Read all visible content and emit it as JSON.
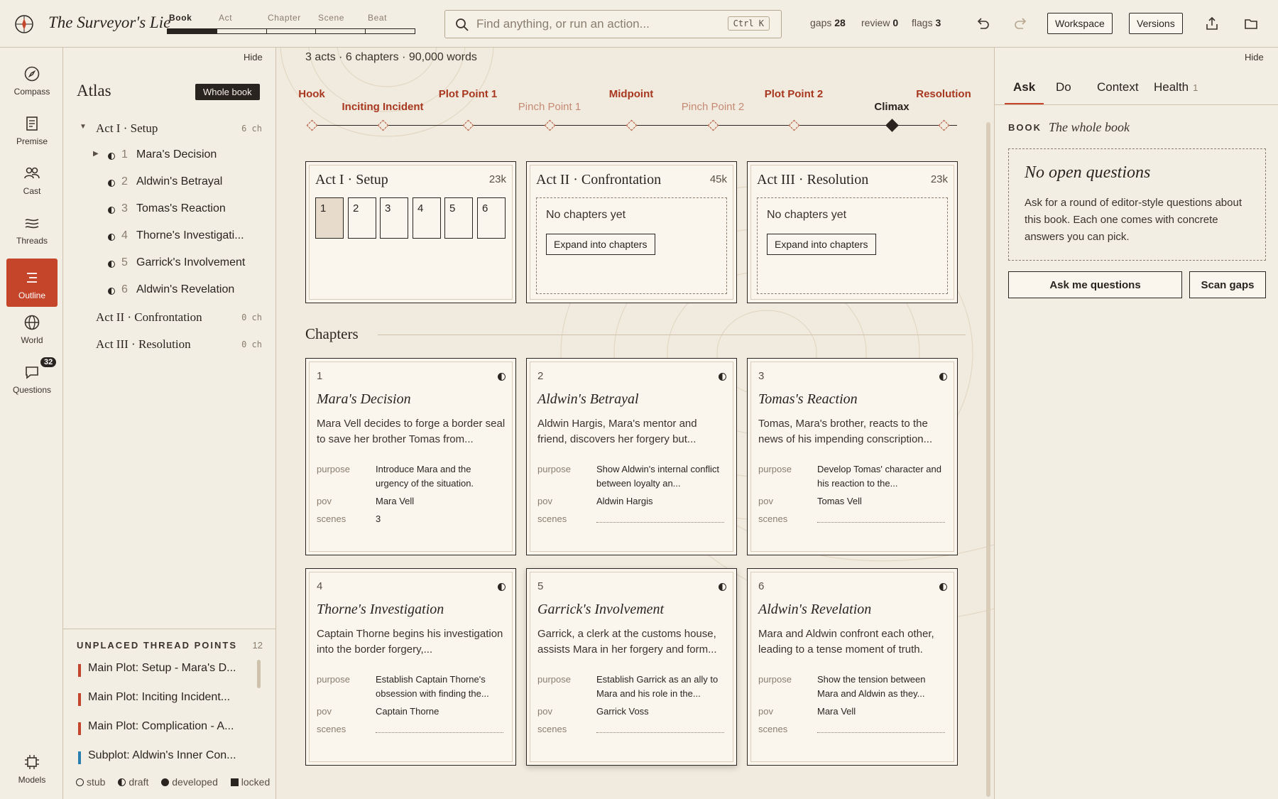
{
  "header": {
    "book_title": "The Surveyor's Lie",
    "scope_tabs": [
      "Book",
      "Act",
      "Chapter",
      "Scene",
      "Beat"
    ],
    "search_placeholder": "Find anything, or run an action...",
    "search_shortcut": "Ctrl K",
    "stats": {
      "gaps_label": "gaps",
      "gaps": "28",
      "review_label": "review",
      "review": "0",
      "flags_label": "flags",
      "flags": "3"
    },
    "workspace_label": "Workspace",
    "versions_label": "Versions"
  },
  "rail": {
    "items": [
      "Compass",
      "Premise",
      "Cast",
      "Threads",
      "Outline",
      "World",
      "Questions"
    ],
    "active": "Outline",
    "questions_badge": "32",
    "models_label": "Models"
  },
  "atlas": {
    "hide_label": "Hide",
    "title": "Atlas",
    "whole_book_label": "Whole book",
    "acts": [
      {
        "label": "Act I · Setup",
        "count": "6 ch"
      },
      {
        "label": "Act II · Confrontation",
        "count": "0 ch"
      },
      {
        "label": "Act III · Resolution",
        "count": "0 ch"
      }
    ],
    "chapters": [
      {
        "num": "1",
        "title": "Mara's Decision"
      },
      {
        "num": "2",
        "title": "Aldwin's Betrayal"
      },
      {
        "num": "3",
        "title": "Tomas's Reaction"
      },
      {
        "num": "4",
        "title": "Thorne's Investigati..."
      },
      {
        "num": "5",
        "title": "Garrick's Involvement"
      },
      {
        "num": "6",
        "title": "Aldwin's Revelation"
      }
    ],
    "unplaced_title": "UNPLACED THREAD POINTS",
    "unplaced_count": "12",
    "thread_points": [
      "Main Plot: Setup - Mara's D...",
      "Main Plot: Inciting Incident...",
      "Main Plot: Complication - A...",
      "Subplot: Aldwin's Inner Con..."
    ],
    "legend": [
      "stub",
      "draft",
      "developed",
      "locked"
    ]
  },
  "main": {
    "stats_line": "3 acts · 6 chapters · 90,000 words",
    "beats": [
      "Hook",
      "Inciting Incident",
      "Plot Point 1",
      "Pinch Point 1",
      "Midpoint",
      "Pinch Point 2",
      "Plot Point 2",
      "Climax",
      "Resolution"
    ],
    "act_cards": [
      {
        "title": "Act I · Setup",
        "words": "23k",
        "chips": [
          "1",
          "2",
          "3",
          "4",
          "5",
          "6"
        ]
      },
      {
        "title": "Act II · Confrontation",
        "words": "45k",
        "empty": "No chapters yet",
        "action": "Expand into chapters"
      },
      {
        "title": "Act III · Resolution",
        "words": "23k",
        "empty": "No chapters yet",
        "action": "Expand into chapters"
      }
    ],
    "chapters_heading": "Chapters",
    "field_labels": {
      "purpose": "purpose",
      "pov": "pov",
      "scenes": "scenes"
    },
    "chapter_cards": [
      {
        "num": "1",
        "title": "Mara's Decision",
        "desc": "Mara Vell decides to forge a border seal to save her brother Tomas from...",
        "purpose": "Introduce Mara and the urgency of the situation.",
        "pov": "Mara Vell",
        "scenes": "3"
      },
      {
        "num": "2",
        "title": "Aldwin's Betrayal",
        "desc": "Aldwin Hargis, Mara's mentor and friend, discovers her forgery but...",
        "purpose": "Show Aldwin's internal conflict between loyalty an...",
        "pov": "Aldwin Hargis",
        "scenes": ""
      },
      {
        "num": "3",
        "title": "Tomas's Reaction",
        "desc": "Tomas, Mara's brother, reacts to the news of his impending conscription...",
        "purpose": "Develop Tomas' character and his reaction to the...",
        "pov": "Tomas Vell",
        "scenes": ""
      },
      {
        "num": "4",
        "title": "Thorne's Investigation",
        "desc": "Captain Thorne begins his investigation into the border forgery,...",
        "purpose": "Establish Captain Thorne's obsession with finding the...",
        "pov": "Captain Thorne",
        "scenes": ""
      },
      {
        "num": "5",
        "title": "Garrick's Involvement",
        "desc": "Garrick, a clerk at the customs house, assists Mara in her forgery and form...",
        "purpose": "Establish Garrick as an ally to Mara and his role in the...",
        "pov": "Garrick Voss",
        "scenes": ""
      },
      {
        "num": "6",
        "title": "Aldwin's Revelation",
        "desc": "Mara and Aldwin confront each other, leading to a tense moment of truth.",
        "purpose": "Show the tension between Mara and Aldwin as they...",
        "pov": "Mara Vell",
        "scenes": ""
      }
    ]
  },
  "right": {
    "hide_label": "Hide",
    "tabs": [
      "Ask",
      "Do",
      "Context",
      "Health"
    ],
    "health_count": "1",
    "book_label": "BOOK",
    "book_value": "The whole book",
    "empty_title": "No open questions",
    "empty_desc": "Ask for a round of editor-style questions about this book. Each one comes with concrete answers you can pick.",
    "ask_label": "Ask me questions",
    "scan_label": "Scan gaps"
  },
  "colors": {
    "accent": "#c5452a",
    "ink": "#2a2420",
    "paper": "#f1ebdf",
    "card": "#faf6ee",
    "thread_blue": "#2a7fb0"
  }
}
